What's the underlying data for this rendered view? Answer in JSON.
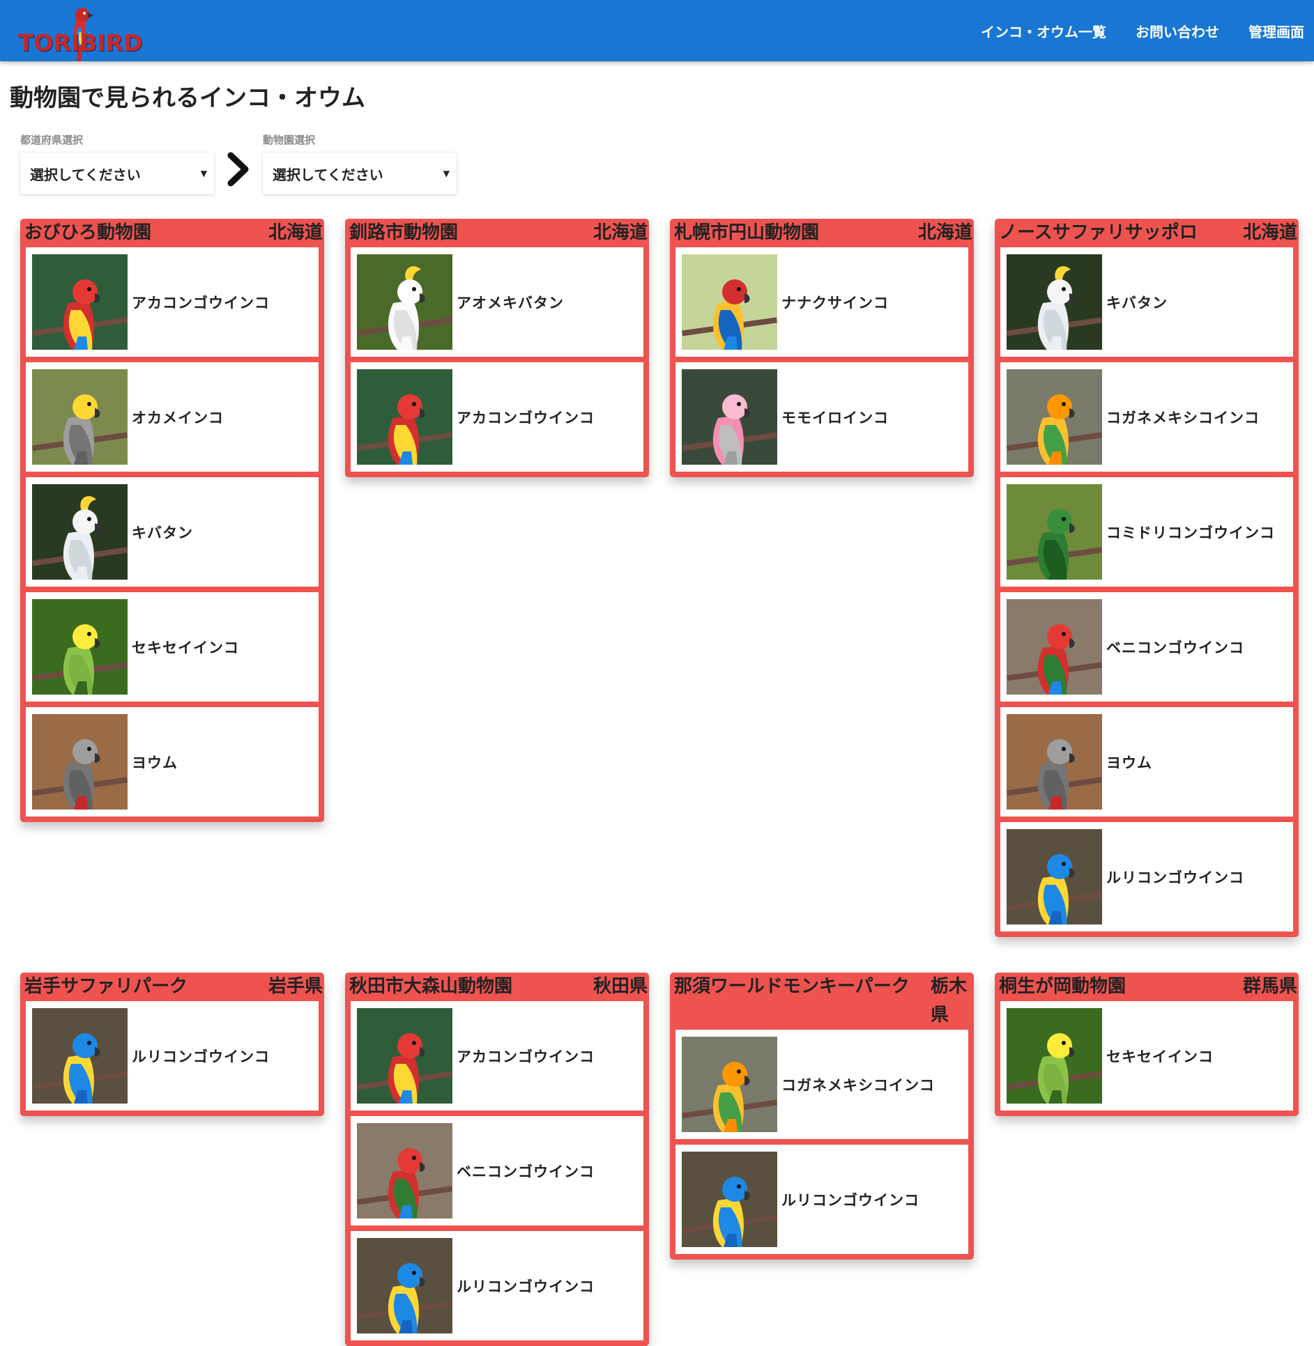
{
  "header": {
    "logo": "TORIBIRD",
    "nav": [
      "インコ・オウム一覧",
      "お問い合わせ",
      "管理画面"
    ]
  },
  "page": {
    "title": "動物園で見られるインコ・オウム"
  },
  "filters": {
    "prefecture": {
      "label": "都道府県選択",
      "value": "選択してください"
    },
    "zoo": {
      "label": "動物園選択",
      "value": "選択してください"
    }
  },
  "zoos": [
    {
      "name": "おびひろ動物園",
      "prefecture": "北海道",
      "birds": [
        "アカコンゴウインコ",
        "オカメインコ",
        "キバタン",
        "セキセイインコ",
        "ヨウム"
      ]
    },
    {
      "name": "釧路市動物園",
      "prefecture": "北海道",
      "birds": [
        "アオメキバタン",
        "アカコンゴウインコ"
      ]
    },
    {
      "name": "札幌市円山動物園",
      "prefecture": "北海道",
      "birds": [
        "ナナクサインコ",
        "モモイロインコ"
      ]
    },
    {
      "name": "ノースサファリサッポロ",
      "prefecture": "北海道",
      "birds": [
        "キバタン",
        "コガネメキシコインコ",
        "コミドリコンゴウインコ",
        "ベニコンゴウインコ",
        "ヨウム",
        "ルリコンゴウインコ"
      ]
    },
    {
      "name": "岩手サファリパーク",
      "prefecture": "岩手県",
      "birds": [
        "ルリコンゴウインコ"
      ]
    },
    {
      "name": "秋田市大森山動物園",
      "prefecture": "秋田県",
      "birds": [
        "アカコンゴウインコ",
        "ベニコンゴウインコ",
        "ルリコンゴウインコ"
      ]
    },
    {
      "name": "那須ワールドモンキーパーク",
      "prefecture": "栃木県",
      "birds": [
        "コガネメキシコインコ",
        "ルリコンゴウインコ"
      ]
    },
    {
      "name": "桐生が岡動物園",
      "prefecture": "群馬県",
      "birds": [
        "セキセイインコ"
      ]
    }
  ],
  "colors": {
    "header": "#1976d2",
    "card": "#ef5350"
  }
}
